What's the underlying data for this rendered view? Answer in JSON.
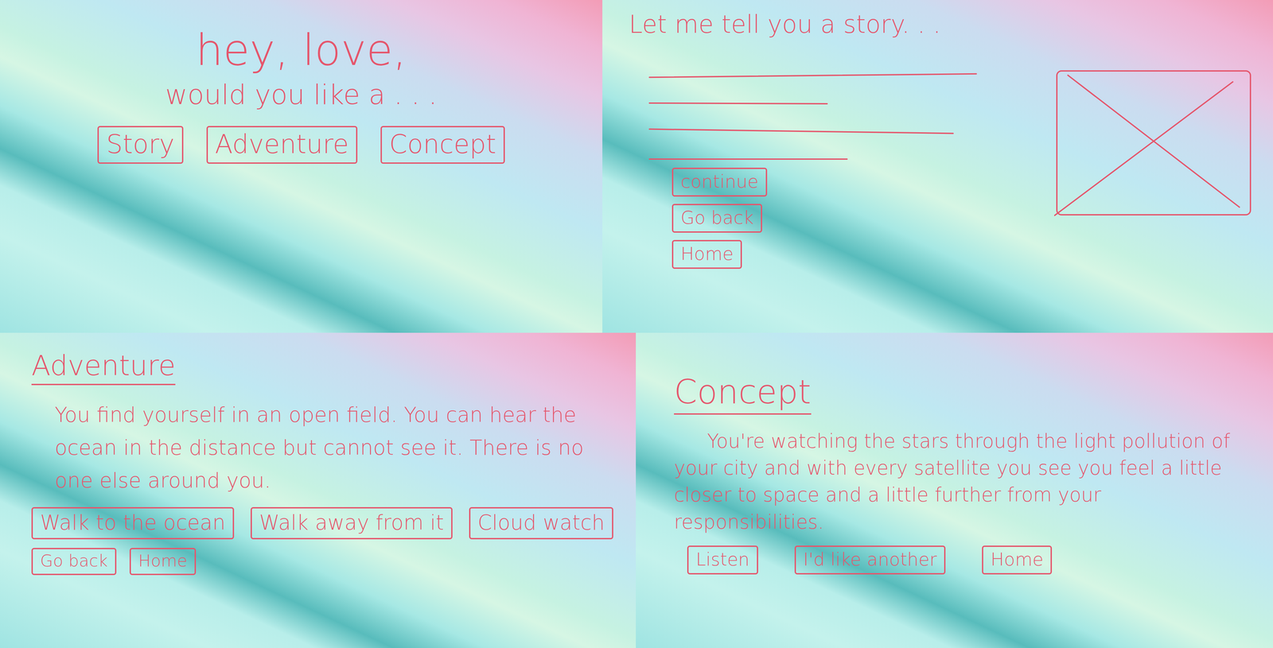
{
  "home": {
    "title": "hey, love,",
    "subtitle": "would you like a . . .",
    "buttons": [
      "Story",
      "Adventure",
      "Concept"
    ]
  },
  "story": {
    "title": "Let me tell you a story. . .",
    "buttons": [
      "continue",
      "Go back",
      "Home"
    ]
  },
  "adventure": {
    "title": "Adventure",
    "body": "You find yourself in an open field. You can hear the ocean in the distance but cannot see it. There is no one else around you.",
    "choices": [
      "Walk to the ocean",
      "Walk away from it",
      "Cloud watch"
    ],
    "nav": [
      "Go back",
      "Home"
    ]
  },
  "concept": {
    "title": "Concept",
    "body": "You're watching the stars through the light pollution of your city and with every satellite you see you feel a little closer to space and a little further from your responsibilities.",
    "buttons": [
      "Listen",
      "I'd like another",
      "Home"
    ]
  }
}
